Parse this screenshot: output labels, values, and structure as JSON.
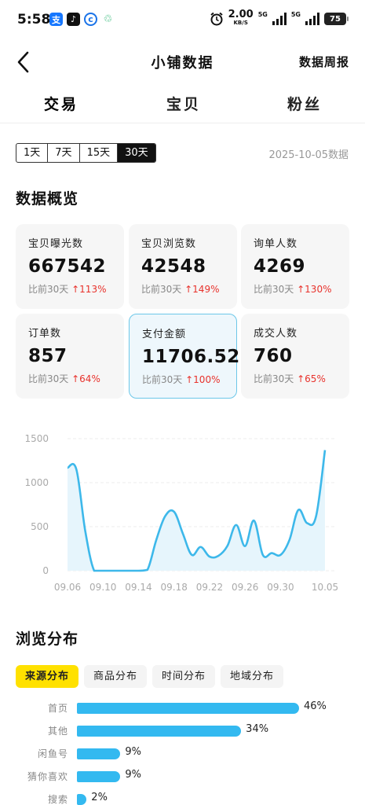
{
  "status": {
    "time": "5:58",
    "speed_value": "2.00",
    "speed_unit": "KB/S",
    "net1": "5G",
    "net2": "5G",
    "battery": "75"
  },
  "header": {
    "title": "小铺数据",
    "right_link": "数据周报"
  },
  "tabs": [
    {
      "label": "交易",
      "active": true
    },
    {
      "label": "宝贝",
      "active": false
    },
    {
      "label": "粉丝",
      "active": false
    }
  ],
  "range": {
    "options": [
      "1天",
      "7天",
      "15天",
      "30天"
    ],
    "selected": "30天",
    "date_label": "2025-10-05数据"
  },
  "overview": {
    "title": "数据概览",
    "cards": [
      {
        "label": "宝贝曝光数",
        "value": "667542",
        "compare": "比前30天",
        "change": "113%"
      },
      {
        "label": "宝贝浏览数",
        "value": "42548",
        "compare": "比前30天",
        "change": "149%"
      },
      {
        "label": "询单人数",
        "value": "4269",
        "compare": "比前30天",
        "change": "130%"
      },
      {
        "label": "订单数",
        "value": "857",
        "compare": "比前30天",
        "change": "64%"
      },
      {
        "label": "支付金额",
        "value": "11706.52",
        "compare": "比前30天",
        "change": "100%"
      },
      {
        "label": "成交人数",
        "value": "760",
        "compare": "比前30天",
        "change": "65%"
      }
    ]
  },
  "chart_data": {
    "type": "area",
    "x": [
      "09.06",
      "09.07",
      "09.08",
      "09.09",
      "09.10",
      "09.11",
      "09.12",
      "09.13",
      "09.14",
      "09.15",
      "09.16",
      "09.17",
      "09.18",
      "09.19",
      "09.20",
      "09.21",
      "09.22",
      "09.23",
      "09.24",
      "09.25",
      "09.26",
      "09.27",
      "09.28",
      "09.29",
      "09.30",
      "10.01",
      "10.02",
      "10.03",
      "10.04",
      "10.05"
    ],
    "x_tick_labels": [
      "09.06",
      "09.10",
      "09.14",
      "09.18",
      "09.22",
      "09.26",
      "09.30",
      "10.05"
    ],
    "values": [
      1170,
      1150,
      450,
      0,
      0,
      0,
      0,
      0,
      0,
      10,
      350,
      620,
      670,
      420,
      180,
      270,
      160,
      170,
      280,
      520,
      280,
      570,
      180,
      200,
      180,
      350,
      690,
      540,
      620,
      1370
    ],
    "y_ticks": [
      0,
      500,
      1000,
      1500
    ],
    "ylim": [
      0,
      1500
    ],
    "line_color": "#3db8ea",
    "fill_color": "#e6f5fc",
    "grid": true
  },
  "browse": {
    "title": "浏览分布",
    "tabs": [
      {
        "label": "来源分布",
        "active": true
      },
      {
        "label": "商品分布",
        "active": false
      },
      {
        "label": "时间分布",
        "active": false
      },
      {
        "label": "地域分布",
        "active": false
      }
    ],
    "bars": [
      {
        "label": "首页",
        "value": 46,
        "pct": "46%"
      },
      {
        "label": "其他",
        "value": 34,
        "pct": "34%"
      },
      {
        "label": "闲鱼号",
        "value": 9,
        "pct": "9%"
      },
      {
        "label": "猜你喜欢",
        "value": 9,
        "pct": "9%"
      },
      {
        "label": "搜索",
        "value": 2,
        "pct": "2%"
      }
    ]
  }
}
